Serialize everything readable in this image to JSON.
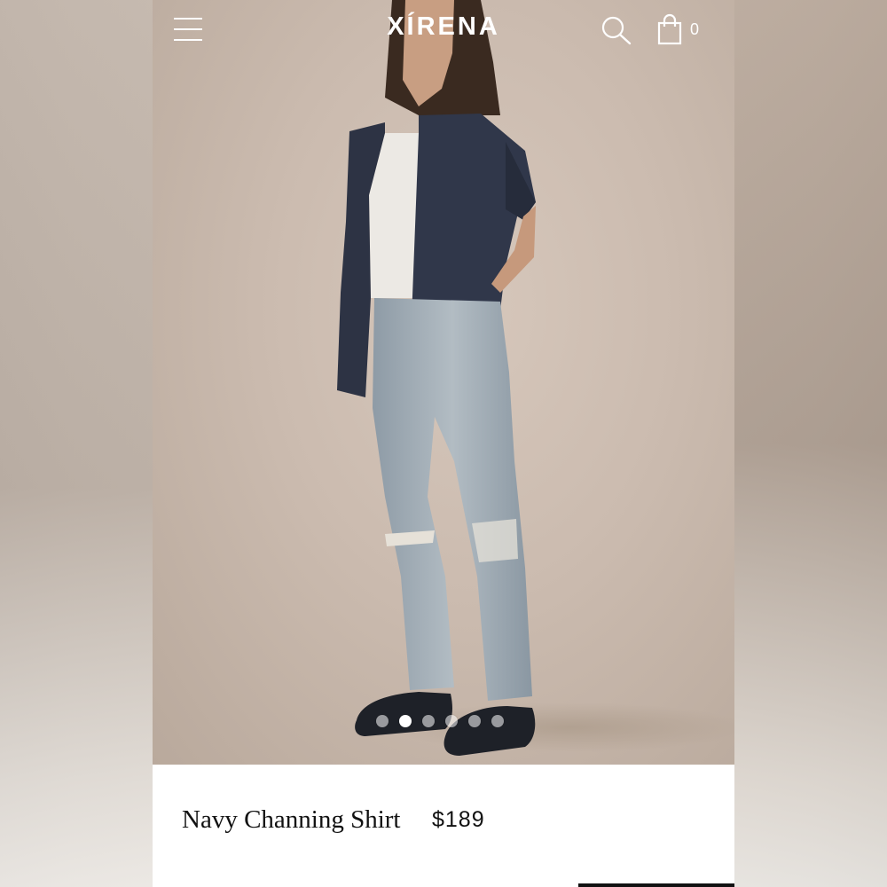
{
  "header": {
    "brand": "XÍRENA",
    "cart_count": "0",
    "menu_icon": "hamburger-menu-icon",
    "search_icon": "search-icon",
    "cart_icon": "shopping-bag-icon"
  },
  "gallery": {
    "slide_count": 6,
    "active_slide": 2
  },
  "product": {
    "name": "Navy Channing Shirt",
    "price": "$189"
  },
  "colors": {
    "brand_text": "#ffffff",
    "shirt": "#2e3445",
    "jeans": "#9aa7b0"
  }
}
